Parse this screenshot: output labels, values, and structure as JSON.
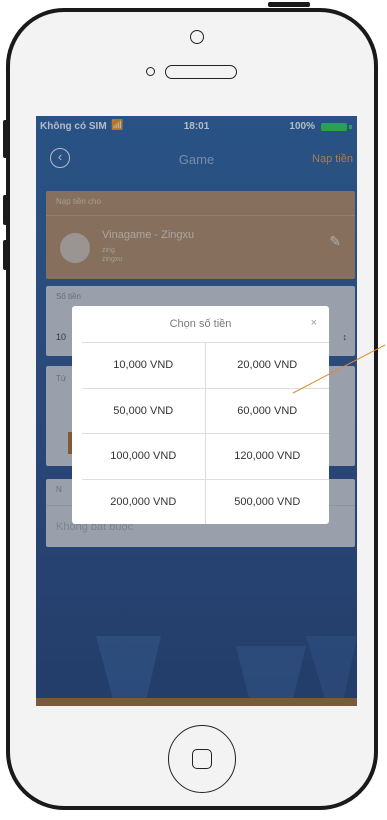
{
  "status_bar": {
    "carrier": "Không có SIM",
    "time": "18:01",
    "battery": "100%"
  },
  "nav": {
    "title": "Game",
    "action": "Nạp tiền"
  },
  "form": {
    "recipient_title": "Nạp tiền cho",
    "game_name": "Vinagame - Zingxu",
    "user_line1": "zing",
    "user_line2": "zingxu",
    "amount_label": "Số tiền",
    "amount_value": "10",
    "note_label": "N",
    "note_placeholder": "Không bắt buộc"
  },
  "modal": {
    "title": "Chọn số tiền",
    "close": "×",
    "options": [
      "10,000 VND",
      "20,000 VND",
      "50,000 VND",
      "60,000 VND",
      "100,000 VND",
      "120,000 VND",
      "200,000 VND",
      "500,000 VND"
    ]
  },
  "colors": {
    "accent": "#e9a14a",
    "callout_line": "#e08a2a",
    "battery": "#2ad84a"
  }
}
